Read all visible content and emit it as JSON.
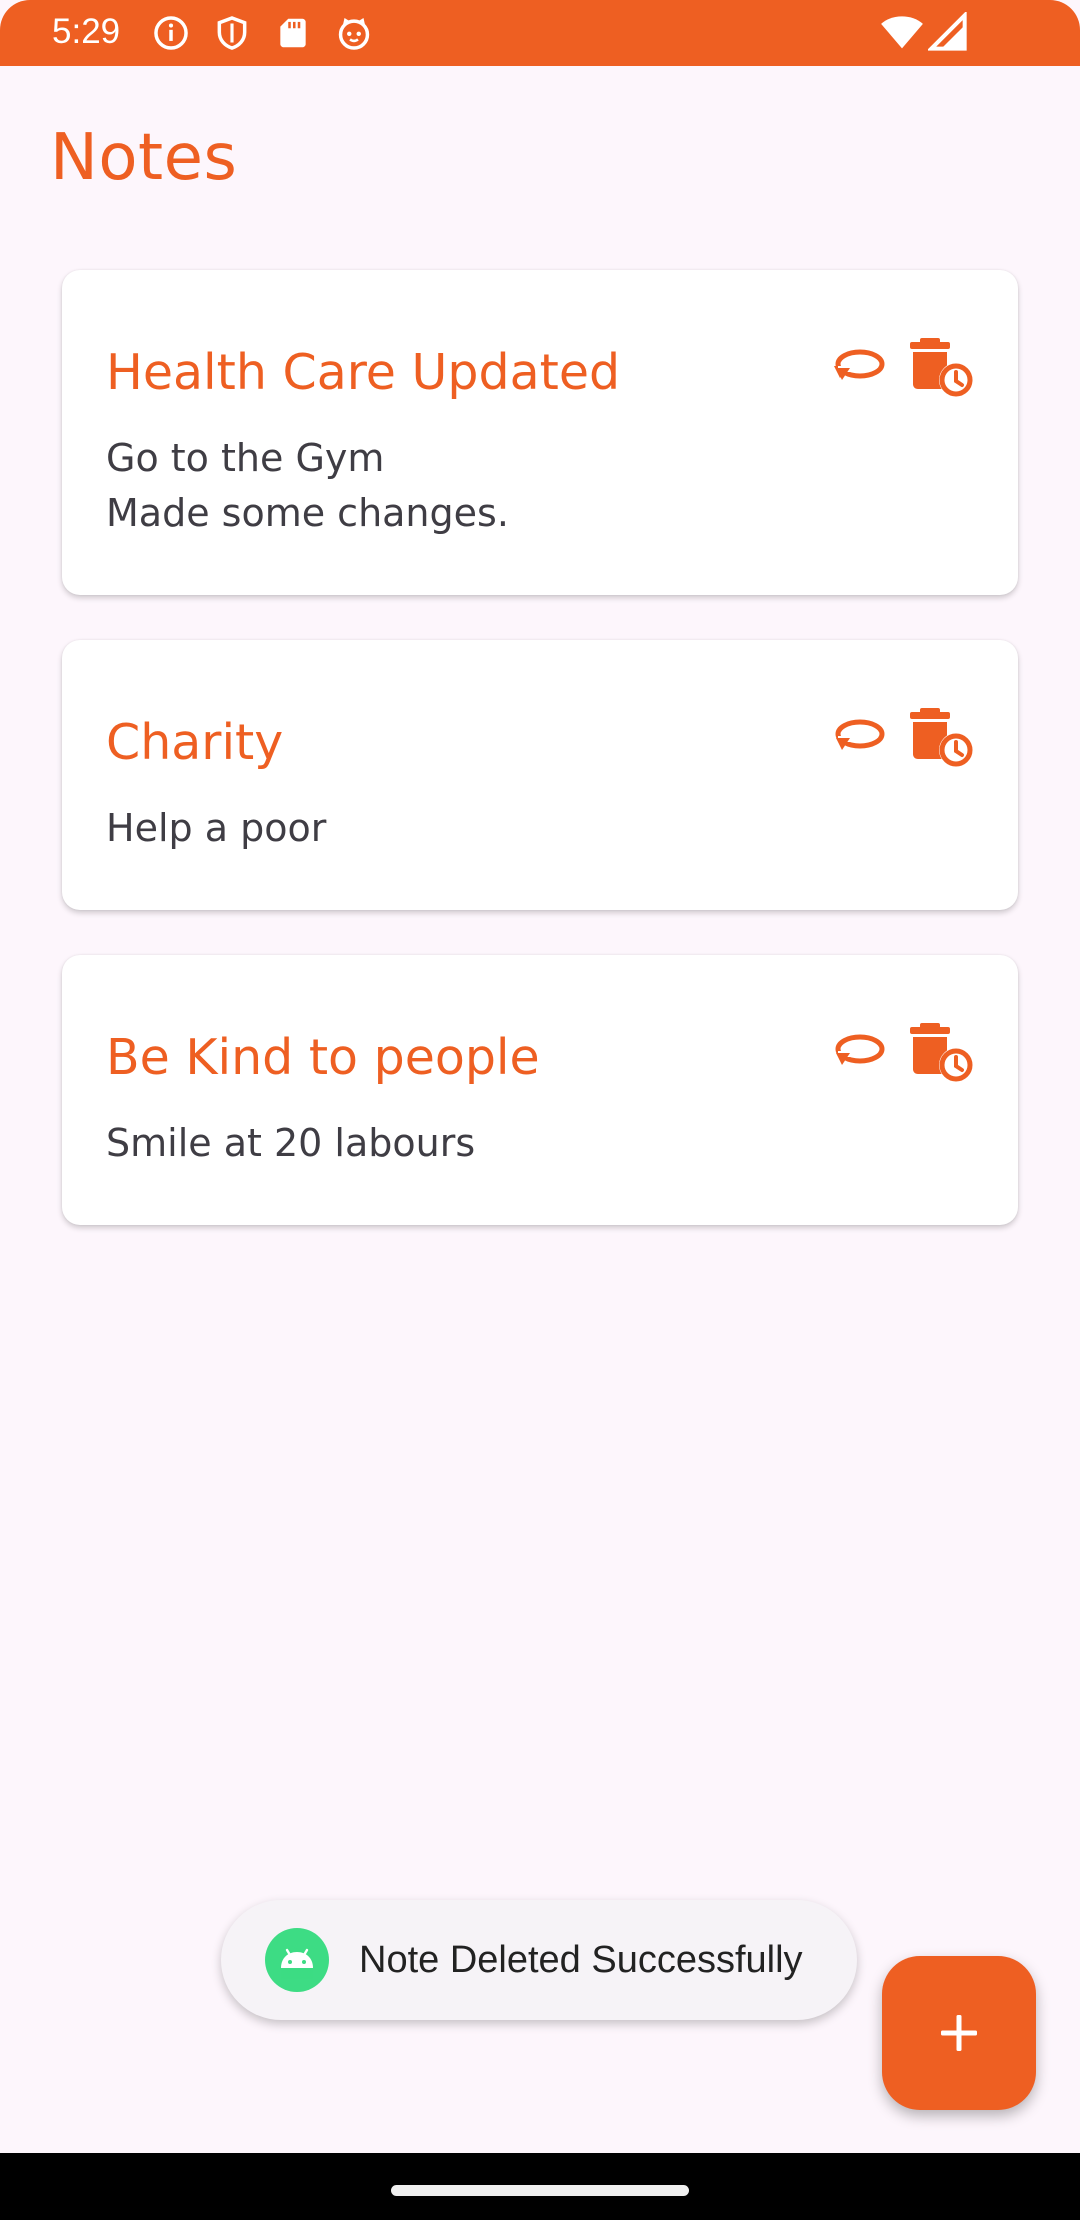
{
  "status_bar": {
    "time": "5:29",
    "background": "#EE5F22",
    "left_icons": [
      "info-icon",
      "shield-icon",
      "sd-card-icon",
      "cat-face-icon"
    ],
    "right_icons": [
      "wifi-icon",
      "signal-icon"
    ]
  },
  "header": {
    "title": "Notes"
  },
  "notes": [
    {
      "title": "Health Care Updated",
      "body": "Go to the Gym\nMade some changes.",
      "actions": [
        "edit-icon",
        "delete-schedule-icon"
      ]
    },
    {
      "title": "Charity",
      "body": "Help a poor",
      "actions": [
        "edit-icon",
        "delete-schedule-icon"
      ]
    },
    {
      "title": "Be Kind to people",
      "body": "Smile at 20 labours",
      "actions": [
        "edit-icon",
        "delete-schedule-icon"
      ]
    }
  ],
  "toast": {
    "message": "Note Deleted Successfully",
    "icon": "android-icon"
  },
  "fab": {
    "icon": "plus-icon"
  },
  "colors": {
    "accent": "#EE5F22",
    "background": "#FDF6FC",
    "card": "#FFFFFF",
    "body_text": "#3F3D44"
  }
}
